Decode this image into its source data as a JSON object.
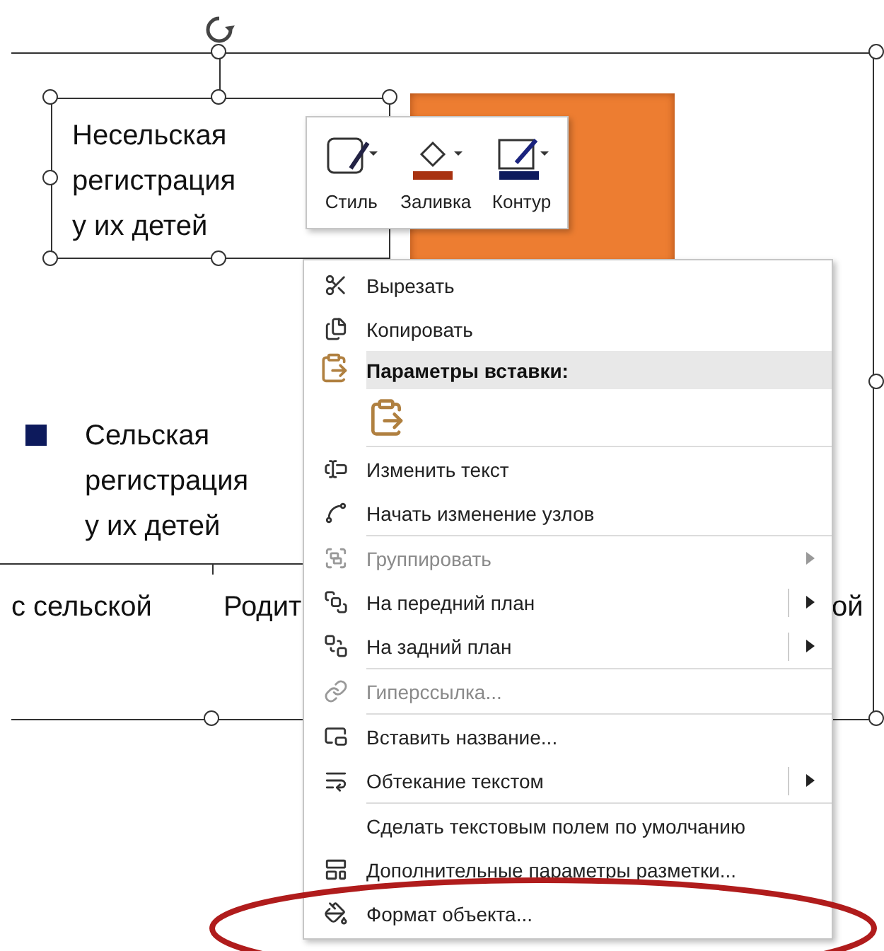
{
  "chart": {
    "selected_textbox": {
      "lines": [
        "Несельская",
        "регистрация",
        "у их детей"
      ]
    },
    "legend": [
      {
        "color": "#0d1a5c",
        "lines": [
          "Сельская",
          "регистрация",
          "у их детей"
        ]
      }
    ],
    "category_labels": [
      "с сельской",
      "Родит",
      "ой"
    ],
    "series_bar": {
      "color": "#ed7d31"
    }
  },
  "mini_toolbar": [
    {
      "label": "Стиль",
      "kind": "style"
    },
    {
      "label": "Заливка",
      "kind": "fill"
    },
    {
      "label": "Контур",
      "kind": "outline"
    }
  ],
  "context_menu": [
    {
      "kind": "item",
      "label": "Вырезать",
      "disabled": false,
      "submenu": false
    },
    {
      "kind": "item",
      "label": "Копировать",
      "disabled": false,
      "submenu": false
    },
    {
      "kind": "header",
      "label": "Параметры вставки:"
    },
    {
      "kind": "paste-option"
    },
    {
      "kind": "separator"
    },
    {
      "kind": "item",
      "label": "Изменить текст",
      "disabled": false,
      "submenu": false
    },
    {
      "kind": "item",
      "label": "Начать изменение узлов",
      "disabled": false,
      "submenu": false
    },
    {
      "kind": "separator"
    },
    {
      "kind": "item",
      "label": "Группировать",
      "disabled": true,
      "submenu": true
    },
    {
      "kind": "item",
      "label": "На передний план",
      "disabled": false,
      "submenu": true
    },
    {
      "kind": "item",
      "label": "На задний план",
      "disabled": false,
      "submenu": true
    },
    {
      "kind": "separator"
    },
    {
      "kind": "item",
      "label": "Гиперссылка...",
      "disabled": true,
      "submenu": false
    },
    {
      "kind": "separator"
    },
    {
      "kind": "item",
      "label": "Вставить название...",
      "disabled": false,
      "submenu": false
    },
    {
      "kind": "item",
      "label": "Обтекание текстом",
      "disabled": false,
      "submenu": true
    },
    {
      "kind": "separator"
    },
    {
      "kind": "item",
      "label": "Сделать текстовым полем по умолчанию",
      "disabled": false,
      "submenu": false
    },
    {
      "kind": "item",
      "label": "Дополнительные параметры разметки...",
      "disabled": false,
      "submenu": false
    },
    {
      "kind": "item",
      "label": "Формат объекта...",
      "disabled": false,
      "submenu": false
    }
  ]
}
